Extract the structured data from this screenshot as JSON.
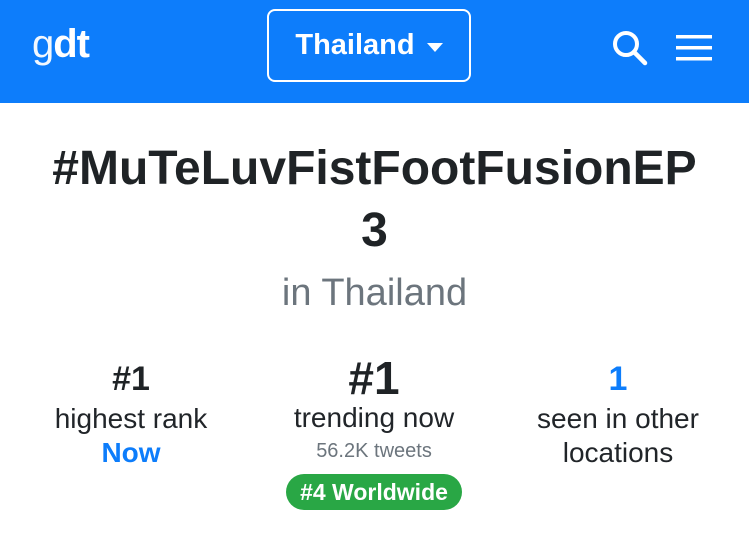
{
  "header": {
    "logo_left": "g",
    "logo_right": "dt",
    "country_label": "Thailand",
    "search_icon": "search-icon",
    "menu_icon": "hamburger-menu-icon",
    "brand_color": "#0d7dfb"
  },
  "trend": {
    "title": "#MuTeLuvFistFootFusionEP3",
    "location_text": "in Thailand"
  },
  "stats": {
    "highest_rank": {
      "value": "#1",
      "label": "highest rank",
      "when": "Now"
    },
    "trending_now": {
      "value": "#1",
      "label": "trending now",
      "tweets": "56.2K tweets",
      "worldwide_badge": "#4 Worldwide"
    },
    "other_locations": {
      "value": "1",
      "label": "seen in other locations"
    }
  },
  "colors": {
    "accent": "#0d7dfb",
    "badge_green": "#29a745",
    "muted_text": "#6c757d"
  }
}
